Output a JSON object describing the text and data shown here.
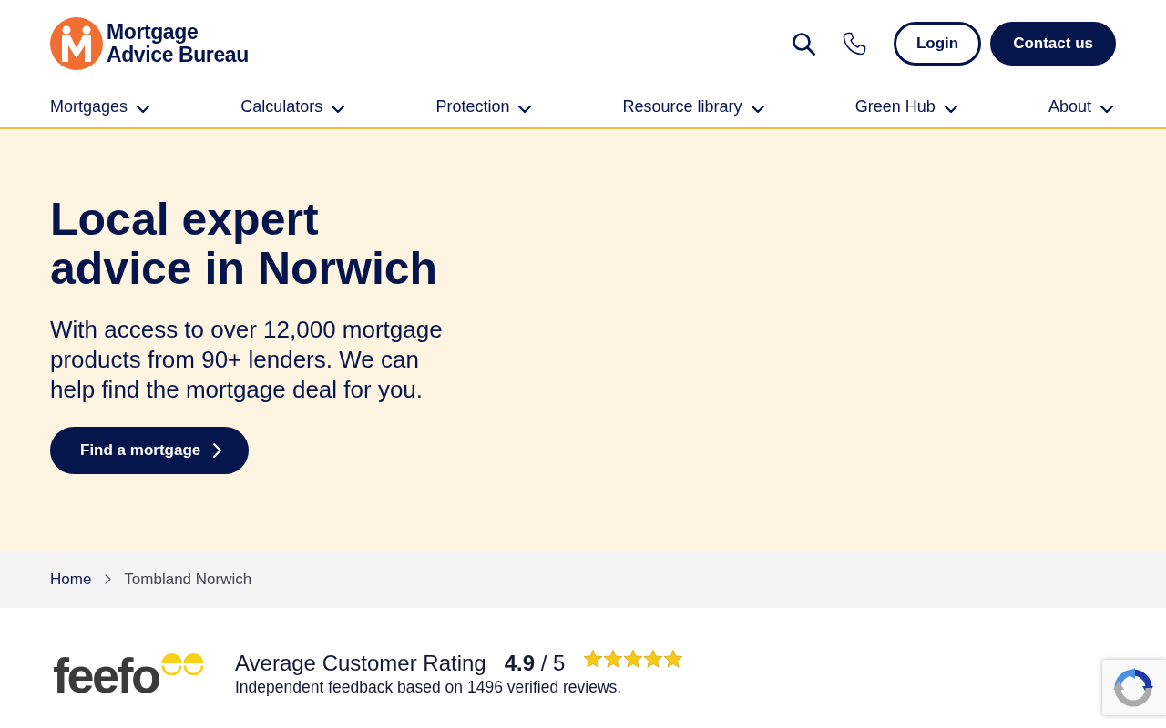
{
  "header": {
    "logo": {
      "lines": [
        "Mortgage",
        "Advice Bureau"
      ]
    },
    "buttons": [
      {
        "label": "Login",
        "kind": "outline"
      },
      {
        "label": "Contact us",
        "kind": "solid"
      }
    ]
  },
  "nav": [
    {
      "label": "Mortgages"
    },
    {
      "label": "Calculators"
    },
    {
      "label": "Protection"
    },
    {
      "label": "Resource library"
    },
    {
      "label": "Green Hub"
    },
    {
      "label": "About"
    }
  ],
  "hero": {
    "title": "Local expert advice in Norwich",
    "text": "With access to over 12,000 mortgage products from 90+ lenders. We can help find the mortgage deal for you.",
    "button": "Find a mortgage"
  },
  "breadcrumb": [
    {
      "label": "Home",
      "kind": "link"
    },
    {
      "label": "Tombland Norwich",
      "kind": "current"
    }
  ],
  "rating": {
    "logo_text": "feefo",
    "heading": "Average Customer Rating",
    "score": "**4.9** / 5",
    "stars": 5,
    "note": "Independent feedback based on 1496 verified reviews."
  }
}
